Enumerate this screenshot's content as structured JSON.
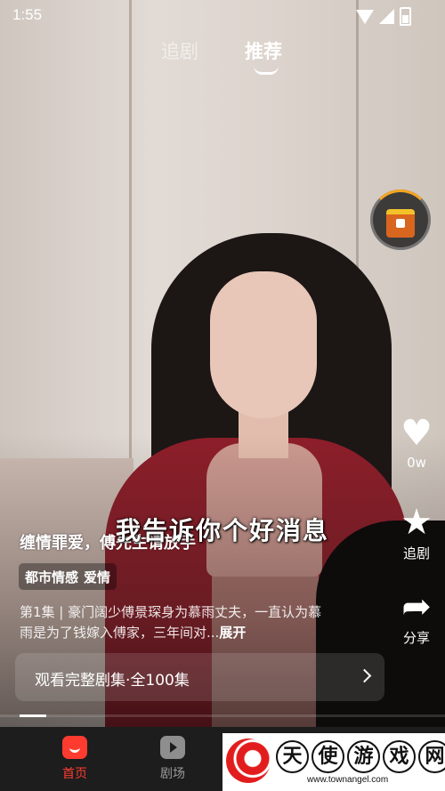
{
  "status_bar": {
    "time": "1:55"
  },
  "top_tabs": {
    "follow": "追剧",
    "recommend": "推荐"
  },
  "actions": {
    "like_count": "0w",
    "follow_label": "追剧",
    "share_label": "分享",
    "heart_glyph": "♥",
    "star_glyph": "★",
    "share_glyph": "➦"
  },
  "video": {
    "subtitle": "我告诉你个好消息",
    "drama_title": "缠情罪爱，傅先生请放手",
    "tags": [
      "都市情感",
      "爱情"
    ],
    "description": "第1集 | 豪门阔少傅景琛身为慕雨丈夫，一直认为慕雨是为了钱嫁入傅家，三年间对...",
    "expand": "展开",
    "watch_full": "观看完整剧集·全100集",
    "progress": 0.06
  },
  "bottom_nav": {
    "home": "首页",
    "theater": "剧场"
  },
  "watermark": {
    "chars": [
      "天",
      "使",
      "游",
      "戏",
      "网"
    ],
    "url": "www.townangel.com"
  },
  "colors": {
    "accent": "#ff3b30",
    "nav_bg": "#1d1d1d"
  }
}
